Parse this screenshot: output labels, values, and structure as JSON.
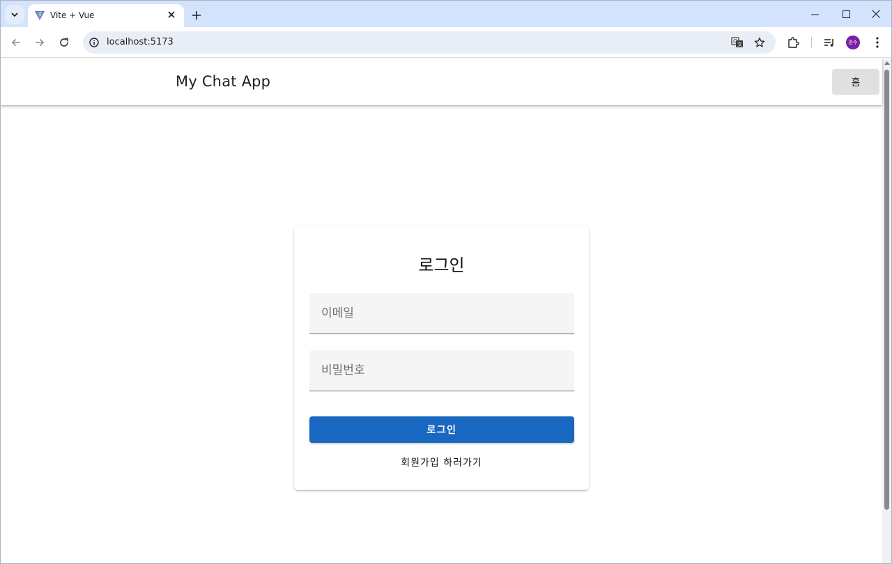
{
  "browser": {
    "tab_title": "Vite + Vue",
    "url": "localhost:5173",
    "profile_initials": "원수",
    "icons": [
      "tab-search-icon",
      "vite-logo-icon",
      "close-icon",
      "plus-icon",
      "minimize-icon",
      "maximize-icon",
      "window-close-icon",
      "back-icon",
      "forward-icon",
      "reload-icon",
      "info-icon",
      "translate-icon",
      "star-icon",
      "extensions-icon",
      "media-controls-icon",
      "more-vert-icon"
    ]
  },
  "app_bar": {
    "title": "My Chat App",
    "home_label": "홈"
  },
  "login": {
    "title": "로그인",
    "email_placeholder": "이메일",
    "password_placeholder": "비밀번호",
    "submit_label": "로그인",
    "signup_link": "회원가입 하러가기"
  },
  "colors": {
    "tabstrip": "#d3e3fd",
    "primary": "#1867c0",
    "field_bg": "#f5f5f5",
    "home_button_bg": "#e0e0e0",
    "profile": "#7b1fa2"
  }
}
